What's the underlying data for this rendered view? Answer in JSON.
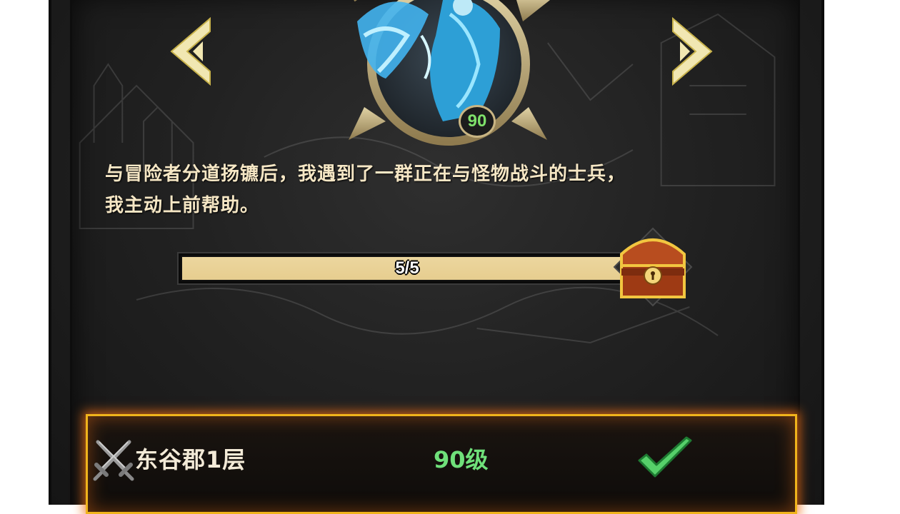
{
  "hero": {
    "level": "90"
  },
  "story": {
    "line1": "与冒险者分道扬镳后，我遇到了一群正在与怪物战斗的士兵，",
    "line2": "我主动上前帮助。"
  },
  "progress": {
    "text": "5/5",
    "current": 5,
    "total": 5
  },
  "stage": {
    "name": "东谷郡1层",
    "level": "90级",
    "completed": true
  },
  "icons": {
    "nav_prev": "chevron-left-icon",
    "nav_next": "chevron-right-icon",
    "reward": "treasure-chest-icon",
    "stage": "crossed-swords-icon",
    "status": "checkmark-icon"
  },
  "colors": {
    "accent_gold": "#f0b41c",
    "level_green": "#6fe07a",
    "progress_fill": "#e6cd8f",
    "story_text": "#f6e7c5"
  }
}
